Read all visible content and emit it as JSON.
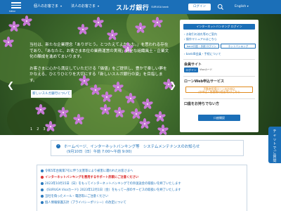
{
  "header": {
    "menu_label": "MENU",
    "nav": [
      "個人のお客さま",
      "法人のお客さま"
    ],
    "logo_text": "スルガ銀行",
    "logo_sub": "SURUGA bank",
    "login_label": "ログイン",
    "language": "English"
  },
  "hero": {
    "paragraph1": "当社は、新たな企業理念「ありがとう。とつたえてよかった。」を思われる存在であり、「あなたと、お客さま本位の業務運営の実現」健全な組織風土・企業文化の醸成を進めてまいります。",
    "paragraph2": "お客さまに心から満足していただける「価値」をご提供し、豊かで楽しい夢をかなえる、ひとりひとりを大切にする「新しいスルガ銀行の姿」を目指します。",
    "button": "新しいスルガ銀行について",
    "dots": [
      "1",
      "2",
      "3"
    ],
    "prev_arrow": "❮",
    "next_arrow": "❯"
  },
  "panel": {
    "ib_login": "インターネットバンキング ログイン",
    "links": [
      "お取引の流れ等のご案内",
      "操作マニュアルはこちら"
    ],
    "btn_left": "bank口座・手続 ログイン",
    "btn_right": "ネットバンキング",
    "sub_link": "bankIB会員・手続について",
    "member_head": "会員サイト",
    "member_btn": "ログイン",
    "member_visa": "Visaカード",
    "loan_head": "ローンWeb申込サービス",
    "loan_btn_line1": "不動産担保ローンのお申込",
    "loan_btn_line2": "(お申込・各書類の提出等)はこちら",
    "account_head": "口座をお持ちでない方",
    "account_btn": "口座開設"
  },
  "chat": {
    "label": "チャットでご質問"
  },
  "notice": {
    "title": "ホームページ、インターネットバンキング等　システムメンテナンスのお知らせ",
    "date": "(9月10日（日）午前 7:00～午前 9:00)"
  },
  "news": [
    {
      "text": "令和5年台風第7号に伴う災害等により被害に遭われたお客さまへ",
      "important": false
    },
    {
      "text": "インターネットバンキングを悪用するサポート詐欺にご注意ください",
      "important": true
    },
    {
      "text": "2023年10月15日（日）をもってインターネットバンキングでの外国送金の取扱いを終了いたします",
      "important": false
    },
    {
      "text": "《SURUGA Visaカード》2023年12月1日（金）をもって一部のサービスの取扱いを終了いたします",
      "important": false
    },
    {
      "text": "当社を偽ったメール・電話等にご注意ください",
      "important": false
    },
    {
      "text": "個人情報保護方針（プライバシーポリシー）の改定について",
      "important": false
    }
  ],
  "colors": {
    "brand": "#1b6fb8",
    "alert": "#d92020",
    "loan_accent": "#e08a1e"
  }
}
